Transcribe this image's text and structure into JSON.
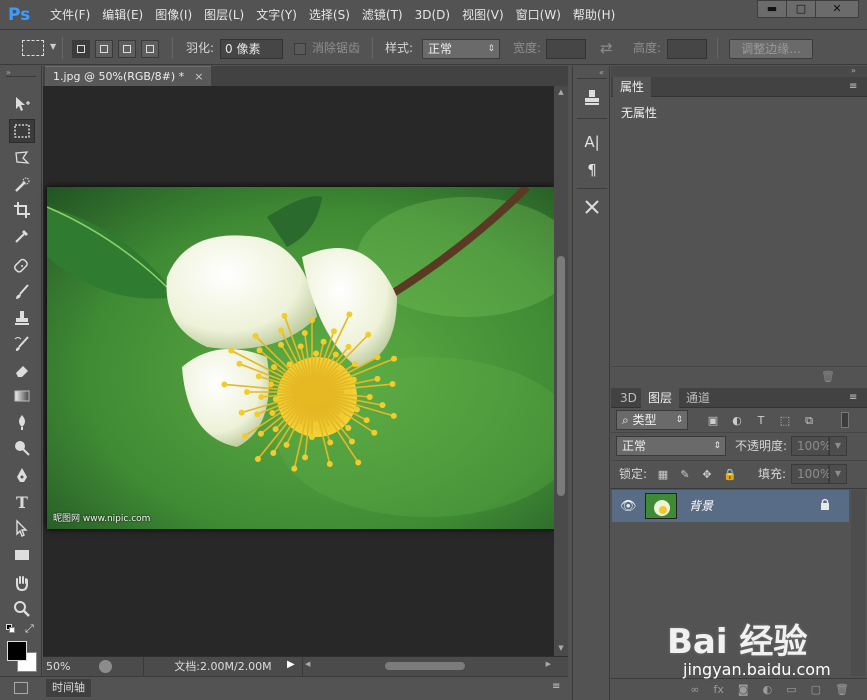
{
  "app": {
    "logo": "Ps"
  },
  "menu": [
    "文件(F)",
    "编辑(E)",
    "图像(I)",
    "图层(L)",
    "文字(Y)",
    "选择(S)",
    "滤镜(T)",
    "3D(D)",
    "视图(V)",
    "窗口(W)",
    "帮助(H)"
  ],
  "window_controls": {
    "minimize": "▬",
    "maximize": "□",
    "close": "✕"
  },
  "options": {
    "feather_label": "羽化:",
    "feather_value": "0 像素",
    "antialias_label": "消除锯齿",
    "style_label": "样式:",
    "style_value": "正常",
    "width_label": "宽度:",
    "height_label": "高度:",
    "refine_edge_button": "调整边缘..."
  },
  "toolbar": {
    "icons": [
      "move-icon",
      "rect-marquee-icon",
      "lasso-icon",
      "quick-select-icon",
      "crop-icon",
      "eyedropper-icon",
      "healing-brush-icon",
      "brush-icon",
      "clone-stamp-icon",
      "history-brush-icon",
      "eraser-icon",
      "gradient-icon",
      "blur-icon",
      "dodge-icon",
      "pen-icon",
      "type-icon",
      "path-select-icon",
      "rectangle-shape-icon",
      "hand-icon",
      "zoom-icon"
    ],
    "type_tool_glyph": "T",
    "foreground_color": "#000000",
    "background_color": "#ffffff"
  },
  "document": {
    "tab_title": "1.jpg @ 50%(RGB/8#) *",
    "tab_close": "×",
    "image_watermark": "昵图网 www.nipic.com"
  },
  "status": {
    "zoom": "50%",
    "doc_size": "文档:2.00M/2.00M"
  },
  "timeline": {
    "tab_label": "时间轴"
  },
  "properties": {
    "tab_label": "属性",
    "empty_text": "无属性"
  },
  "layers": {
    "tabs": [
      "3D",
      "图层",
      "通道"
    ],
    "active_tab_index": 1,
    "filter_kind": "类型",
    "blend_mode": "正常",
    "opacity_label": "不透明度:",
    "opacity_value": "100%",
    "lock_label": "锁定:",
    "fill_label": "填充:",
    "fill_value": "100%",
    "items": [
      {
        "name": "背景",
        "visible": true,
        "locked": true
      }
    ]
  },
  "mid_panel": {
    "char_label": "A|",
    "para_label": "¶"
  },
  "watermark": {
    "logo": "Bai 经验",
    "url": "jingyan.baidu.com"
  }
}
